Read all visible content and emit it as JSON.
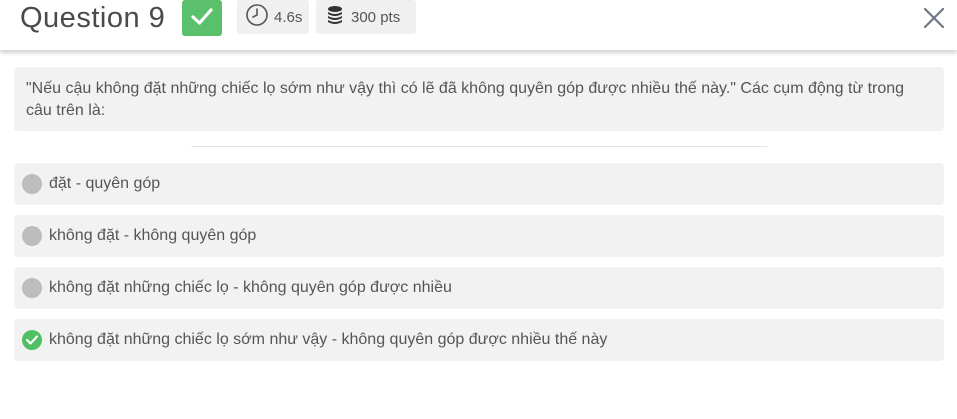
{
  "header": {
    "question_title": "Question 9",
    "time": "4.6s",
    "points": "300 pts"
  },
  "question": {
    "text": "\"Nếu cậu không đặt những chiếc lọ sớm như vậy thì có lẽ đã không quyên góp được nhiều thế này.\" Các cụm động từ trong câu trên là:"
  },
  "options": [
    {
      "label": "đặt - quyên góp",
      "correct": false
    },
    {
      "label": "không đặt - không quyên góp",
      "correct": false
    },
    {
      "label": "không đặt những chiếc lọ - không quyên góp được nhiều",
      "correct": false
    },
    {
      "label": "không đặt những chiếc lọ sớm như vậy - không quyên góp được nhiều thế này",
      "correct": true
    }
  ],
  "colors": {
    "correct_green": "#5bc06b",
    "neutral_radio": "#bdbdbd",
    "panel_bg": "#f2f2f2"
  },
  "icons": {
    "badge": "check-icon",
    "time": "clock-icon",
    "points": "coins-icon",
    "close": "close-icon"
  }
}
